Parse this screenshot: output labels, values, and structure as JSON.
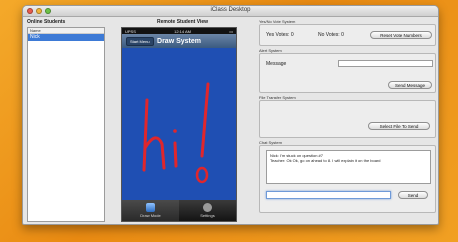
{
  "window": {
    "title": "iClass Desktop"
  },
  "students": {
    "label": "Online Students",
    "column_header": "Name",
    "rows": [
      "Nick"
    ]
  },
  "remote_view": {
    "label": "Remote Student View",
    "status_left": "UPSS",
    "status_time": "12:14 AM",
    "back_button": "Start Menu",
    "screen_title": "Draw System",
    "drawing_text": "hi!",
    "tabs": [
      {
        "label": "Draw Mode",
        "icon": "draw-icon"
      },
      {
        "label": "Settings",
        "icon": "gear-icon"
      }
    ],
    "canvas_color": "#1f4fb3",
    "ink_color": "#e0262c"
  },
  "vote_system": {
    "label": "Yes/No Vote System",
    "yes_votes": "Yes Votes: 0",
    "no_votes": "No Votes: 0",
    "reset_button": "Reset Vote Numbers"
  },
  "alert_system": {
    "label": "Alert System",
    "message_label": "Message",
    "message_value": "",
    "send_button": "Send Message"
  },
  "file_transfer": {
    "label": "File Transfer System",
    "select_button": "Select File To Send"
  },
  "chat_system": {
    "label": "Chat System",
    "messages": [
      "Nick: I'm stuck on question #7",
      "Teacher: Ok Ok, go on ahead to 8. I will explain it on the board"
    ],
    "input_value": "",
    "send_button": "Send"
  }
}
